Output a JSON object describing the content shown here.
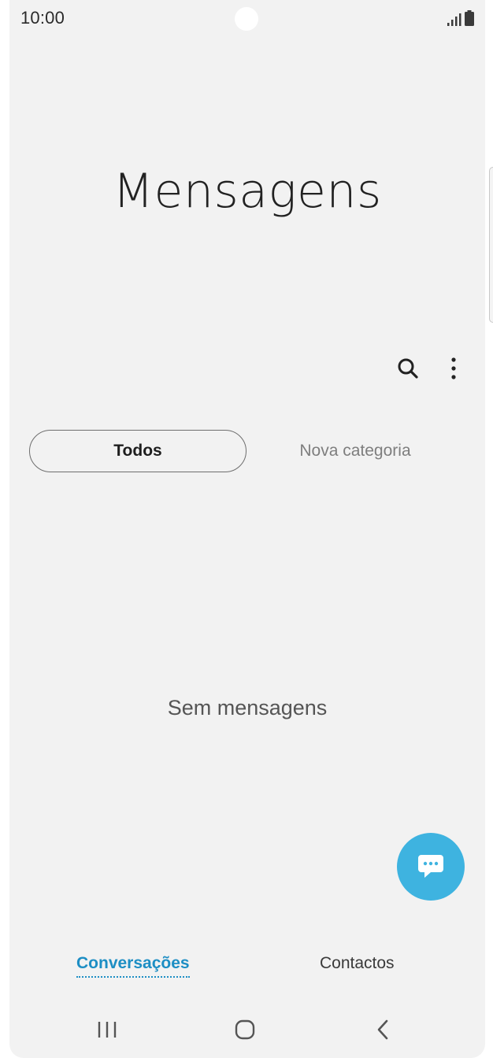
{
  "status_bar": {
    "time": "10:00",
    "icons": [
      "signal-icon",
      "battery-icon"
    ]
  },
  "header": {
    "title": "Mensagens"
  },
  "toolbar": {
    "icons": [
      "search-icon",
      "more-options-icon"
    ]
  },
  "filters": {
    "tabs": [
      {
        "label": "Todos",
        "selected": true
      },
      {
        "label": "Nova categoria",
        "selected": false
      }
    ]
  },
  "main": {
    "empty_text": "Sem mensagens"
  },
  "fab": {
    "icon": "compose-message-icon",
    "color": "#3eb3e0"
  },
  "bottom_tabs": [
    {
      "label": "Conversações",
      "active": true
    },
    {
      "label": "Contactos",
      "active": false
    }
  ],
  "nav_bar": {
    "icons": [
      "recent-apps-icon",
      "home-icon",
      "back-icon"
    ]
  },
  "colors": {
    "accent": "#1d8ec4",
    "background": "#f2f2f2"
  }
}
